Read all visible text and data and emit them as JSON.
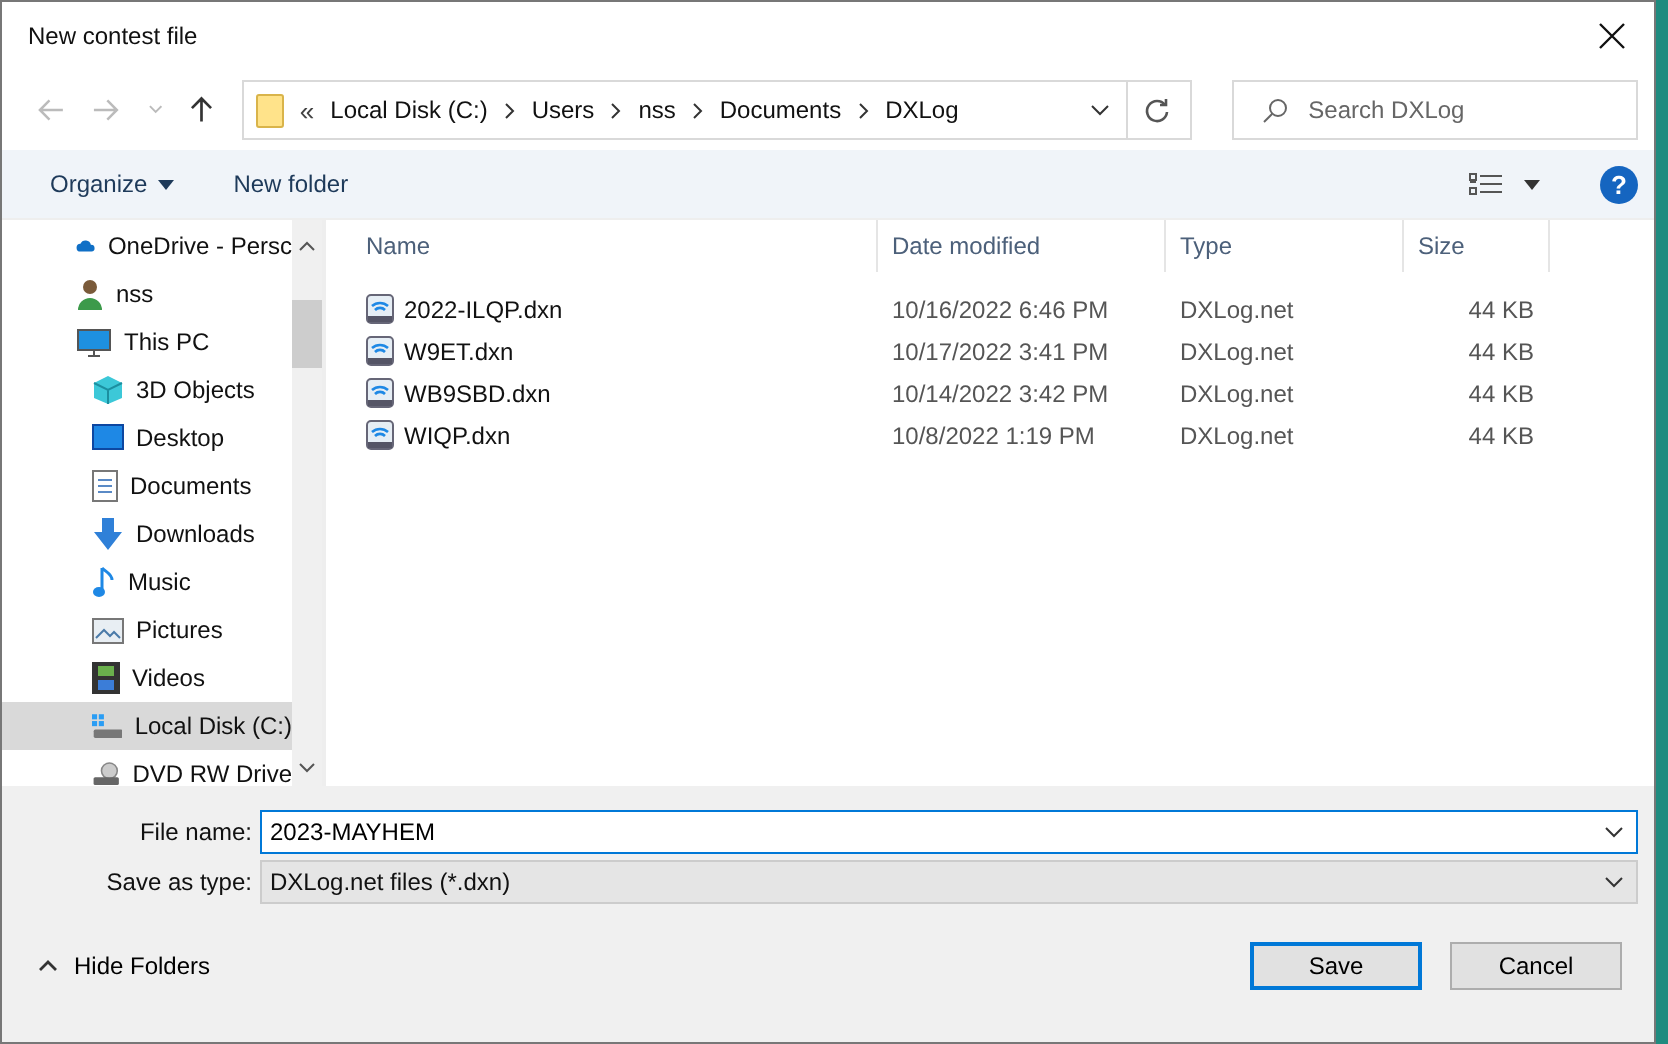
{
  "window": {
    "title": "New contest file"
  },
  "breadcrumb_overflow": "«",
  "breadcrumb": [
    "Local Disk (C:)",
    "Users",
    "nss",
    "Documents",
    "DXLog"
  ],
  "search": {
    "placeholder": "Search DXLog"
  },
  "toolbar": {
    "organize": "Organize",
    "new_folder": "New folder",
    "help": "?"
  },
  "sidebar": {
    "items": [
      {
        "label": "OneDrive - Persc",
        "kind": "cloud",
        "selected": false
      },
      {
        "label": "nss",
        "kind": "user",
        "selected": false
      },
      {
        "label": "This PC",
        "kind": "pc",
        "selected": false,
        "children": [
          {
            "label": "3D Objects",
            "kind": "cube",
            "selected": false
          },
          {
            "label": "Desktop",
            "kind": "desktop",
            "selected": false
          },
          {
            "label": "Documents",
            "kind": "document",
            "selected": false
          },
          {
            "label": "Downloads",
            "kind": "download",
            "selected": false
          },
          {
            "label": "Music",
            "kind": "music",
            "selected": false
          },
          {
            "label": "Pictures",
            "kind": "picture",
            "selected": false
          },
          {
            "label": "Videos",
            "kind": "video",
            "selected": false
          },
          {
            "label": "Local Disk (C:)",
            "kind": "disk",
            "selected": true
          },
          {
            "label": "DVD RW Drive",
            "kind": "dvd",
            "selected": false
          }
        ]
      }
    ]
  },
  "table": {
    "columns": [
      "Name",
      "Date modified",
      "Type",
      "Size"
    ],
    "rows": [
      {
        "name": "2022-ILQP.dxn",
        "date": "10/16/2022 6:46 PM",
        "type": "DXLog.net",
        "size": "44 KB"
      },
      {
        "name": "W9ET.dxn",
        "date": "10/17/2022 3:41 PM",
        "type": "DXLog.net",
        "size": "44 KB"
      },
      {
        "name": "WB9SBD.dxn",
        "date": "10/14/2022 3:42 PM",
        "type": "DXLog.net",
        "size": "44 KB"
      },
      {
        "name": "WIQP.dxn",
        "date": "10/8/2022 1:19 PM",
        "type": "DXLog.net",
        "size": "44 KB"
      }
    ]
  },
  "file_name": {
    "label": "File name:",
    "value": "2023-MAYHEM"
  },
  "save_as_type": {
    "label": "Save as type:",
    "value": "DXLog.net files (*.dxn)"
  },
  "hide_folders": "Hide Folders",
  "buttons": [
    "Save",
    "Cancel"
  ]
}
